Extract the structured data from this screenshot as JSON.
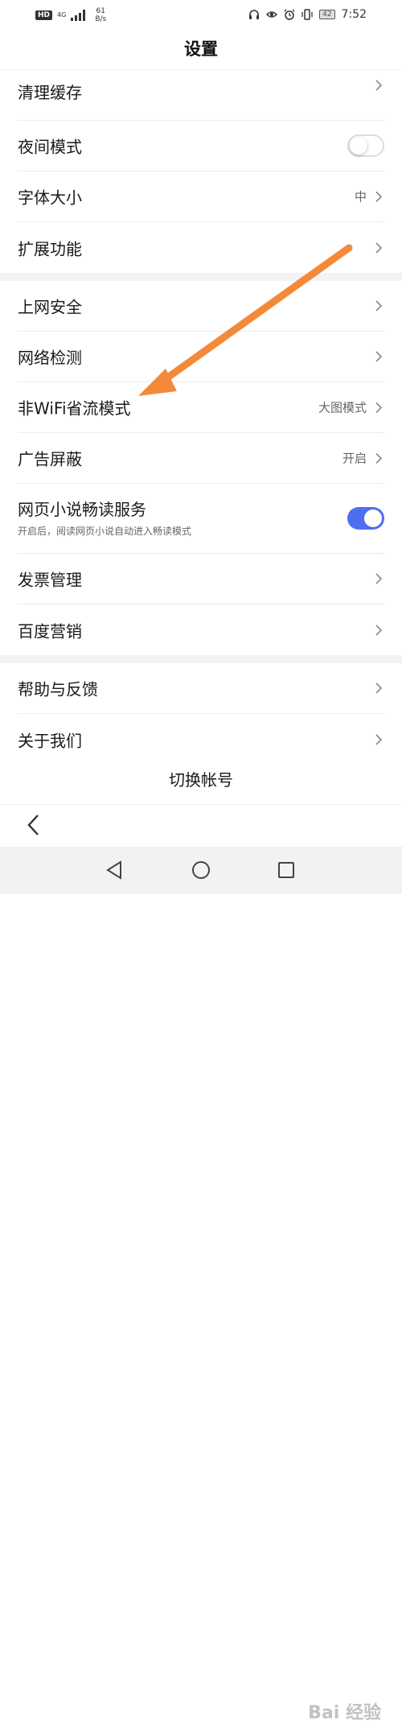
{
  "status_bar": {
    "hd": "HD",
    "network": "4G",
    "speed_value": "61",
    "speed_unit": "B/s",
    "battery": "42",
    "time": "7:52"
  },
  "header": {
    "title": "设置"
  },
  "sections": [
    {
      "items": [
        {
          "label": "清理缓存",
          "control": "chevron"
        },
        {
          "label": "夜间模式",
          "control": "toggle",
          "on": false
        },
        {
          "label": "字体大小",
          "value": "中",
          "control": "chevron"
        },
        {
          "label": "扩展功能",
          "control": "chevron"
        }
      ]
    },
    {
      "items": [
        {
          "label": "上网安全",
          "control": "chevron"
        },
        {
          "label": "网络检测",
          "control": "chevron"
        },
        {
          "label": "非WiFi省流模式",
          "value": "大图模式",
          "control": "chevron"
        },
        {
          "label": "广告屏蔽",
          "value": "开启",
          "control": "chevron"
        },
        {
          "label": "网页小说畅读服务",
          "sublabel": "开启后，阅读网页小说自动进入畅读模式",
          "control": "toggle",
          "on": true
        },
        {
          "label": "发票管理",
          "control": "chevron"
        },
        {
          "label": "百度营销",
          "control": "chevron"
        }
      ]
    },
    {
      "items": [
        {
          "label": "帮助与反馈",
          "control": "chevron"
        },
        {
          "label": "关于我们",
          "control": "chevron"
        }
      ]
    }
  ],
  "footer": {
    "switch_account": "切换帐号"
  },
  "watermark": "Bai 经验",
  "colors": {
    "accent": "#4e6ef2",
    "annotation_arrow": "#f28a3a"
  }
}
